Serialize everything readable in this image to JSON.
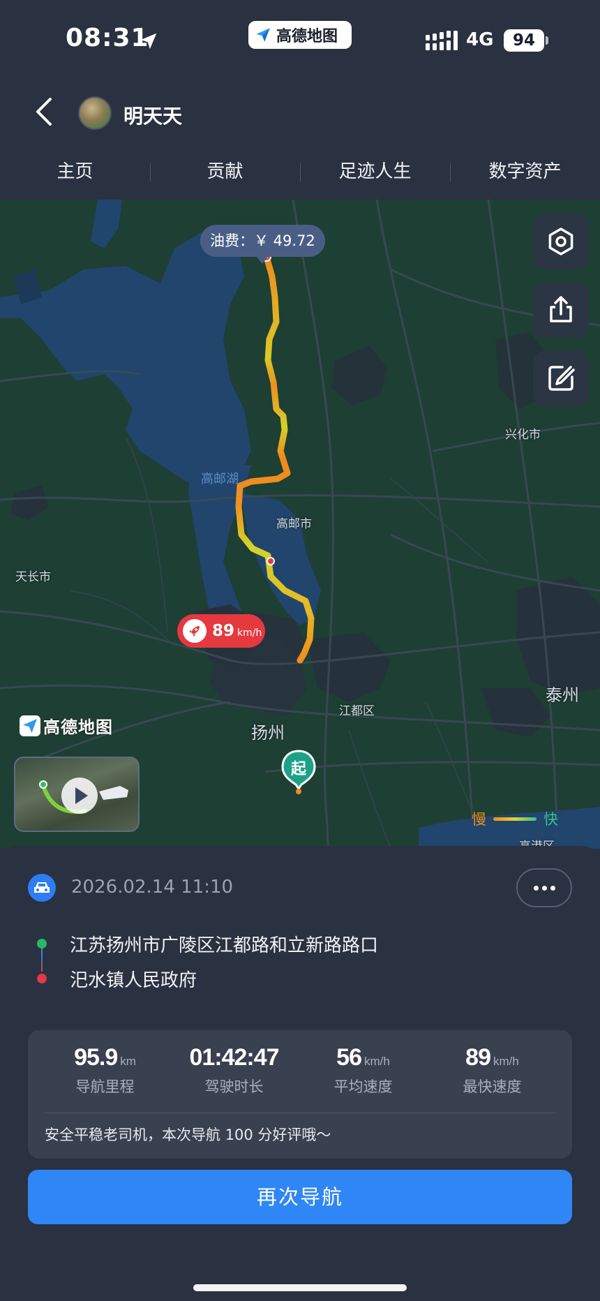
{
  "status_bar": {
    "time": "08:31",
    "app_badge": "高德地图",
    "network": "4G",
    "battery": "94"
  },
  "header": {
    "username": "明天天",
    "tabs": [
      "主页",
      "贡献",
      "足迹人生",
      "数字资产"
    ]
  },
  "map": {
    "fuel_cost": "油费：￥ 49.72",
    "max_speed_value": "89",
    "max_speed_unit": "km/h",
    "start_label": "起",
    "logo_text": "高德地图",
    "labels": {
      "lake": "高邮湖",
      "gaoyou": "高邮市",
      "xinghua": "兴化市",
      "tianchang": "天长市",
      "jiangdu": "江都区",
      "yangzhou": "扬州",
      "taizhou": "泰州",
      "gaogang": "高港区"
    },
    "legend_slow": "慢",
    "legend_fast": "快",
    "icons": [
      "settings-icon",
      "share-icon",
      "edit-icon",
      "finish-flag-icon",
      "rocket-icon",
      "play-icon"
    ],
    "colors": {
      "slow": "#f28c1c",
      "fast": "#35c08c",
      "speed_tag": "#e5393f"
    }
  },
  "trip": {
    "datetime": "2026.02.14 11:10",
    "from": "江苏扬州市广陵区江都路和立新路路口",
    "to": "汜水镇人民政府",
    "stats": [
      {
        "value": "95.9",
        "unit": "km",
        "label": "导航里程"
      },
      {
        "value": "01:42:47",
        "unit": "",
        "label": "驾驶时长"
      },
      {
        "value": "56",
        "unit": "km/h",
        "label": "平均速度"
      },
      {
        "value": "89",
        "unit": "km/h",
        "label": "最快速度"
      }
    ],
    "comment": "安全平稳老司机，本次导航 100 分好评哦～",
    "button": "再次导航"
  },
  "accent_color": "#2f86f6"
}
